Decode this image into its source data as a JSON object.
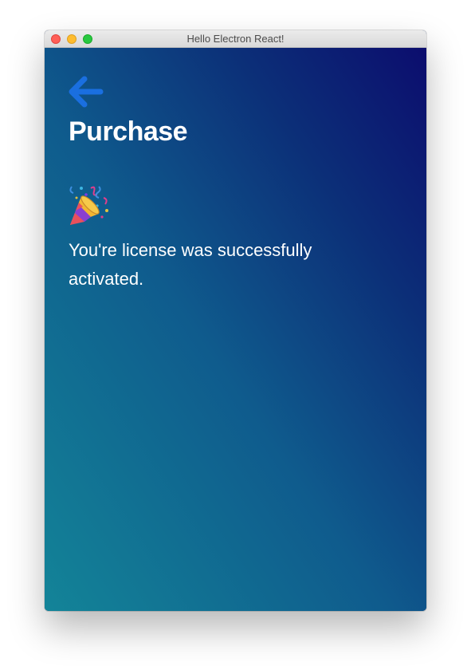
{
  "window": {
    "title": "Hello Electron React!"
  },
  "page": {
    "back_icon": "arrow-left-icon",
    "heading": "Purchase",
    "celebration_icon": "party-popper-icon",
    "message": "You're license was successfully activated."
  },
  "colors": {
    "back_arrow": "#1a6fe0",
    "text": "#ffffff",
    "gradient_dark": "#0c0d6e",
    "gradient_teal": "#138498"
  }
}
